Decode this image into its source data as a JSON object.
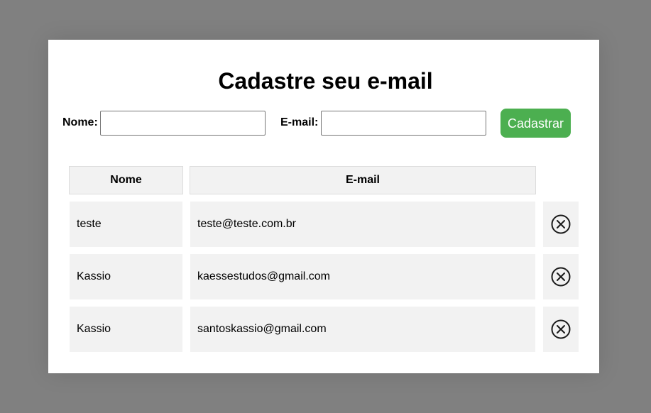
{
  "form": {
    "title": "Cadastre seu e-mail",
    "name_label": "Nome:",
    "email_label": "E-mail:",
    "name_value": "",
    "email_value": "",
    "submit_label": "Cadastrar"
  },
  "table": {
    "columns": [
      "Nome",
      "E-mail"
    ],
    "rows": [
      {
        "nome": "teste",
        "email": "teste@teste.com.br"
      },
      {
        "nome": "Kassio",
        "email": "kaessestudos@gmail.com"
      },
      {
        "nome": "Kassio",
        "email": "santoskassio@gmail.com"
      }
    ],
    "delete_icon": "circle-x-icon"
  },
  "colors": {
    "background": "#808080",
    "card": "#ffffff",
    "accent": "#4caf50",
    "cell_bg": "#f2f2f2"
  }
}
